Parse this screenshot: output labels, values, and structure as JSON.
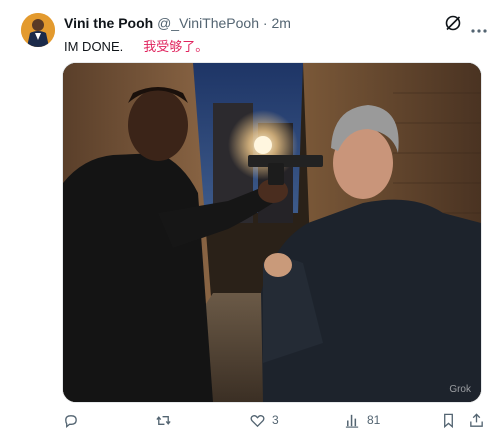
{
  "post": {
    "author_name": "Vini the Pooh",
    "handle": "@_ViniThePooh",
    "separator": "·",
    "time": "2m",
    "text_en": "IM DONE.",
    "text_zh": "我受够了。"
  },
  "media": {
    "watermark": "Grok"
  },
  "actions": {
    "replies": "",
    "reposts": "",
    "likes": "3",
    "views": "81"
  },
  "icons": [
    "grok-icon",
    "more-icon",
    "reply-icon",
    "repost-icon",
    "like-icon",
    "views-icon",
    "bookmark-icon",
    "share-icon"
  ],
  "colors": {
    "text": "#0f1419",
    "secondary": "#536471",
    "translation": "#e0245e"
  }
}
